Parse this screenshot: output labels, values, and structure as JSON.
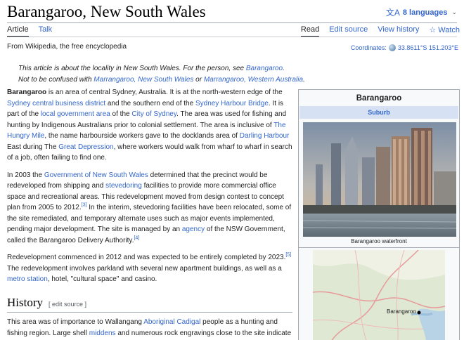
{
  "page": {
    "title": "Barangaroo, New South Wales",
    "languages": "8 languages",
    "tabs_left": [
      "Article",
      "Talk"
    ],
    "tabs_right": [
      "Read",
      "Edit source",
      "View history",
      "Watch"
    ],
    "from": "From Wikipedia, the free encyclopedia",
    "coordinates_label": "Coordinates:",
    "coordinates_value": "33.8611°S 151.203°E"
  },
  "hatnote": {
    "l1_a": "This article is about the locality in New South Wales. For the person, see ",
    "l1_link": "Barangaroo",
    "l1_b": ".",
    "l2_a": "Not to be confused with ",
    "l2_link1": "Marrangaroo, New South Wales",
    "l2_b": " or ",
    "l2_link2": "Marrangaroo, Western Australia",
    "l2_c": "."
  },
  "p1": {
    "bold": "Barangaroo",
    "t1": " is an area of central Sydney, Australia. It is at the north-western edge of the ",
    "l1": "Sydney central business district",
    "t2": " and the southern end of the ",
    "l2": "Sydney Harbour Bridge",
    "t3": ". It is part of the ",
    "l3": "local government area",
    "t4": " of the ",
    "l4": "City of Sydney",
    "t5": ". The area was used for fishing and hunting by Indigenous Australians prior to colonial settlement. The area is inclusive of ",
    "l5": "The Hungry Mile",
    "t6": ", the name harbourside workers gave to the docklands area of ",
    "l6": "Darling Harbour",
    "t7": " East during The ",
    "l7": "Great Depression",
    "t8": ", where workers would walk from wharf to wharf in search of a job, often failing to find one."
  },
  "p2": {
    "t1": "In 2003 the ",
    "l1": "Government of New South Wales",
    "t2": " determined that the precinct would be redeveloped from shipping and ",
    "l2": "stevedoring",
    "t3": " facilities to provide more commercial office space and recreational areas. This redevelopment moved from design contest to concept plan from 2005 to 2012.",
    "r1": "[3]",
    "t4": " In the interim, stevedoring facilities have been relocated, some of the site remediated, and temporary alternate uses such as major events implemented, pending major development. The site is managed by an ",
    "l3": "agency",
    "t5": " of the NSW Government, called the Barangaroo Delivery Authority.",
    "r2": "[4]"
  },
  "p3": {
    "t1": "Redevelopment commenced in 2012 and was expected to be entirely completed by 2023.",
    "r1": "[5]",
    "t2": " The redevelopment involves parkland with several new apartment buildings, as well as a ",
    "l1": "metro station",
    "t3": ", hotel, \"cultural space\" and casino."
  },
  "history": {
    "heading": "History",
    "edit": "[ edit source ]",
    "t1": "This area was of importance to Wallangang ",
    "l1": "Aboriginal Cadigal",
    "t2": " people as a hunting and fishing region. Large shell ",
    "l2": "middens",
    "t3": " and numerous rock engravings close to the site indicate"
  },
  "infobox": {
    "title": "Barangaroo",
    "subtitle": "Suburb",
    "caption": "Barangaroo waterfront",
    "map_label": "Barangaroo"
  }
}
